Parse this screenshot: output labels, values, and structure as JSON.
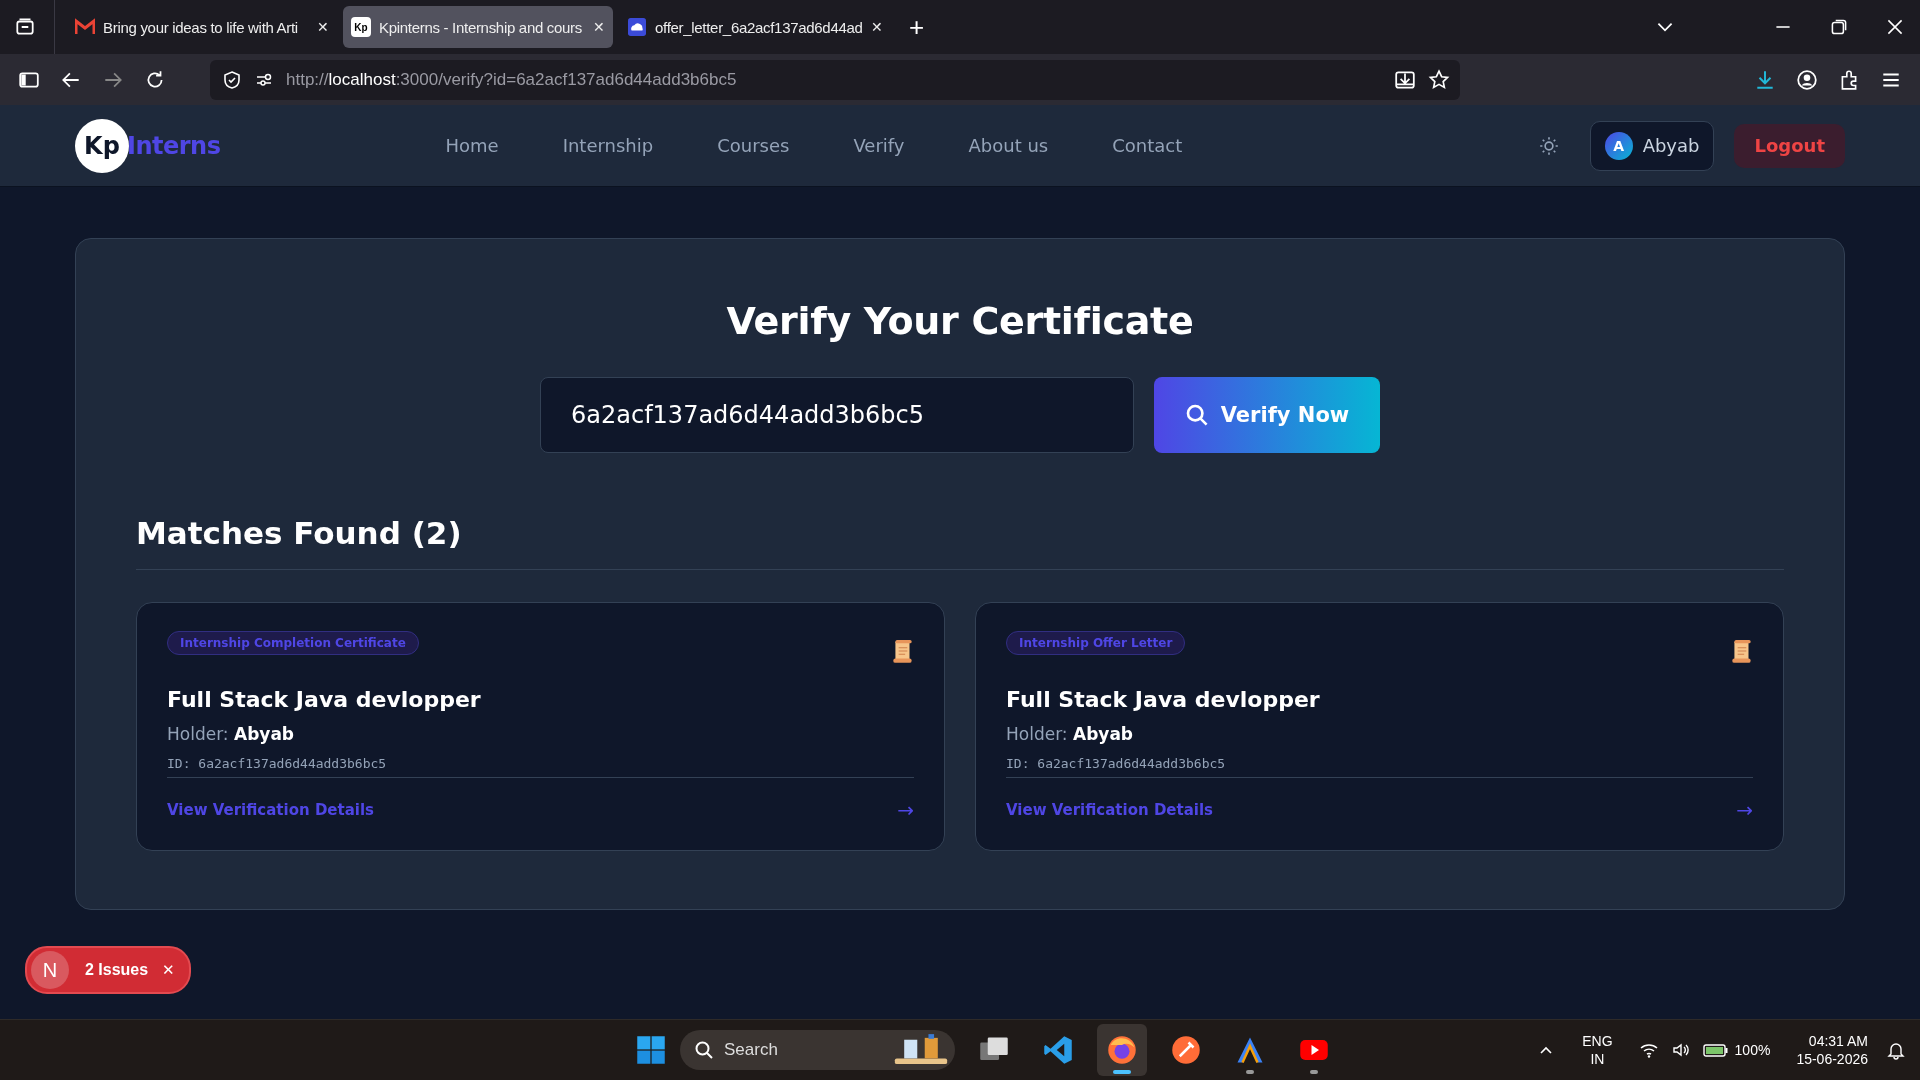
{
  "browser": {
    "tabs": [
      {
        "title": "Bring your ideas to life with Arti",
        "kind": "mail",
        "selected": false
      },
      {
        "title": "Kpinterns - Internship and cours",
        "kind": "site",
        "selected": true
      },
      {
        "title": "offer_letter_6a2acf137ad6d44ad",
        "kind": "cloud",
        "selected": false
      }
    ],
    "close_glyph": "✕",
    "new_tab_glyph": "+",
    "favicon_text": "Kp",
    "url": {
      "scheme": "http://",
      "host": "localhost",
      "rest": ":3000/verify?id=6a2acf137ad6d44add3b6bc5"
    }
  },
  "nav": {
    "logo": {
      "mark": "Kp",
      "word": "Interns"
    },
    "links": [
      {
        "label": "Home"
      },
      {
        "label": "Internship"
      },
      {
        "label": "Courses"
      },
      {
        "label": "Verify"
      },
      {
        "label": "About us"
      },
      {
        "label": "Contact"
      }
    ],
    "user": {
      "initial": "A",
      "name": "Abyab"
    },
    "logout": "Logout"
  },
  "verify": {
    "title": "Verify Your Certificate",
    "search_value": "6a2acf137ad6d44add3b6bc5",
    "button": "Verify Now",
    "matches_heading": "Matches Found (2)",
    "results": [
      {
        "tag": "Internship Completion Certificate",
        "title": "Full Stack Java devlopper",
        "holder_label": "Holder:",
        "holder": "Abyab",
        "id": "ID: 6a2acf137ad6d44add3b6bc5",
        "link": "View Verification Details",
        "arrow": "→"
      },
      {
        "tag": "Internship Offer Letter",
        "title": "Full Stack Java devlopper",
        "holder_label": "Holder:",
        "holder": "Abyab",
        "id": "ID: 6a2acf137ad6d44add3b6bc5",
        "link": "View Verification Details",
        "arrow": "→"
      }
    ]
  },
  "issues_badge": {
    "letter": "N",
    "label": "2 Issues",
    "close": "✕"
  },
  "taskbar": {
    "search_placeholder": "Search",
    "apps": [
      {
        "kind": "files",
        "selected": false,
        "running": false
      },
      {
        "kind": "code",
        "selected": false,
        "running": false
      },
      {
        "kind": "browser",
        "selected": true,
        "running": true
      },
      {
        "kind": "postman",
        "selected": false,
        "running": false
      },
      {
        "kind": "arc",
        "selected": false,
        "running": true
      },
      {
        "kind": "video",
        "selected": false,
        "running": true
      }
    ],
    "language": "ENG",
    "region": "IN",
    "battery": "100%",
    "time": "04:31 AM",
    "date": "15-06-2026"
  }
}
